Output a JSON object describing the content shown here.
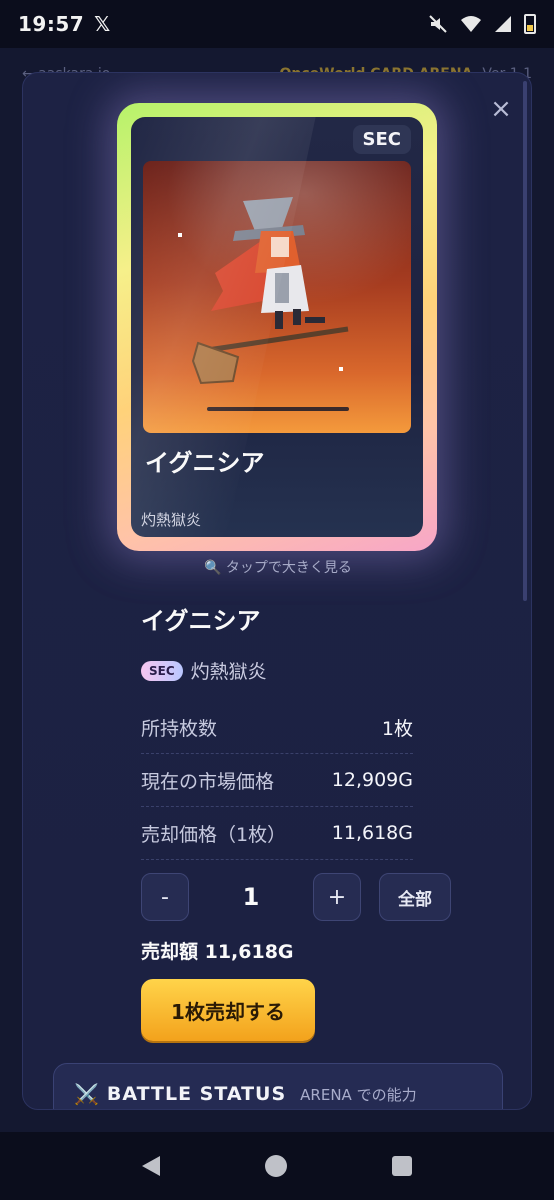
{
  "status_bar": {
    "time": "19:57",
    "x_logo": "𝕏"
  },
  "background": {
    "back_link": "← aaskara.io",
    "app_title": "OnceWorld CARD ARENA",
    "version": "Ver 1.1"
  },
  "card": {
    "rarity_badge": "SEC",
    "name": "イグニシア",
    "rarity_text": "灼熱獄炎",
    "tap_hint": "🔍 タップで大きく見る"
  },
  "details": {
    "title": "イグニシア",
    "rarity_pill": "SEC",
    "rarity_label": "灼熱獄炎",
    "rows": [
      {
        "label": "所持枚数",
        "value": "1枚"
      },
      {
        "label": "現在の市場価格",
        "value": "12,909G"
      },
      {
        "label": "売却価格（1枚）",
        "value": "11,618G"
      }
    ]
  },
  "quantity": {
    "minus": "-",
    "value": "1",
    "plus": "+",
    "all": "全部"
  },
  "total_label": "売却額 11,618G",
  "sell_button": "1枚売却する",
  "battle": {
    "icon": "⚔️",
    "title": "BATTLE STATUS",
    "subtitle": "ARENA での能力"
  },
  "close": "×"
}
